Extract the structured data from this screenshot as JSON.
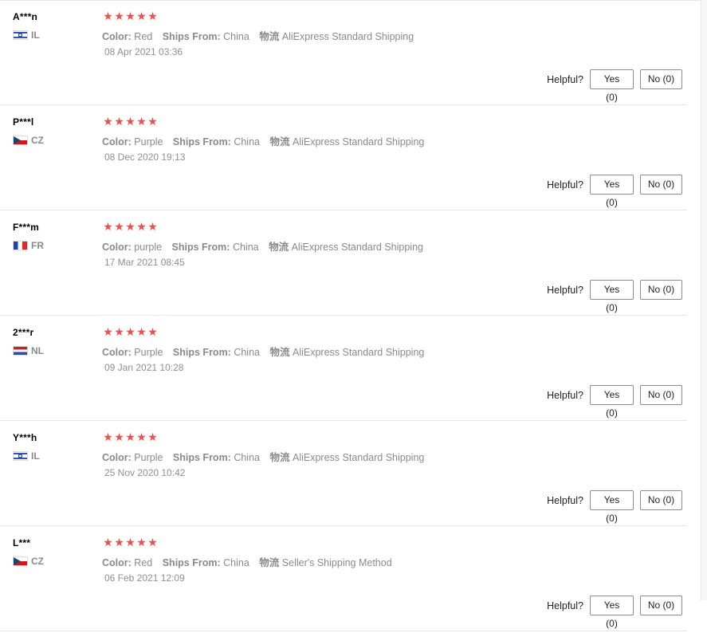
{
  "ui": {
    "helpful_label": "Helpful?",
    "yes_label": "Yes (0)",
    "no_label": "No (0)",
    "labels": {
      "color": "Color:",
      "ships_from": "Ships From:",
      "logistics": "物流"
    },
    "rating_color": "#f44b4b"
  },
  "reviews": [
    {
      "name": "A***n",
      "country": "IL",
      "flag": "flag-il",
      "rating": 5,
      "color": "Red",
      "ships_from": "China",
      "logistics": "AliExpress Standard Shipping",
      "date": "08 Apr 2021 03:36",
      "yes": "Yes (0)",
      "no": "No (0)"
    },
    {
      "name": "P***l",
      "country": "CZ",
      "flag": "flag-cz",
      "rating": 5,
      "color": "Purple",
      "ships_from": "China",
      "logistics": "AliExpress Standard Shipping",
      "date": "08 Dec 2020 19:13",
      "yes": "Yes (0)",
      "no": "No (0)"
    },
    {
      "name": "F***m",
      "country": "FR",
      "flag": "flag-fr",
      "rating": 5,
      "color": "purple",
      "ships_from": "China",
      "logistics": "AliExpress Standard Shipping",
      "date": "17 Mar 2021 08:45",
      "yes": "Yes (0)",
      "no": "No (0)"
    },
    {
      "name": "2***r",
      "country": "NL",
      "flag": "flag-nl",
      "rating": 5,
      "color": "Purple",
      "ships_from": "China",
      "logistics": "AliExpress Standard Shipping",
      "date": "09 Jan 2021 10:28",
      "yes": "Yes (0)",
      "no": "No (0)"
    },
    {
      "name": "Y***h",
      "country": "IL",
      "flag": "flag-il",
      "rating": 5,
      "color": "Purple",
      "ships_from": "China",
      "logistics": "AliExpress Standard Shipping",
      "date": "25 Nov 2020 10:42",
      "yes": "Yes (0)",
      "no": "No (0)"
    },
    {
      "name": "L***",
      "country": "CZ",
      "flag": "flag-cz",
      "rating": 5,
      "color": "Red",
      "ships_from": "China",
      "logistics": "Seller's Shipping Method",
      "date": "06 Feb 2021 12:09",
      "yes": "Yes (0)",
      "no": "No (0)"
    }
  ]
}
